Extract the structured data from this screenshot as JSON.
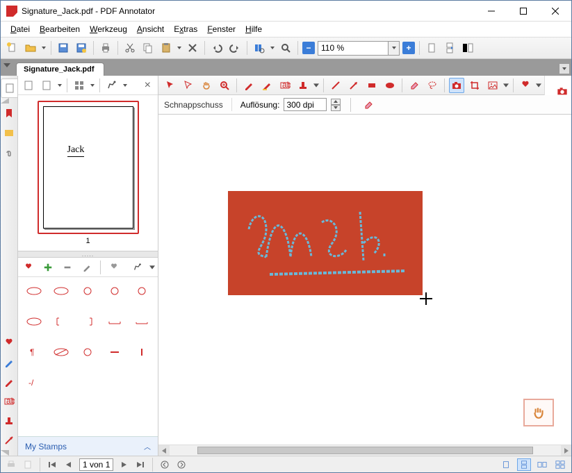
{
  "window": {
    "title": "Signature_Jack.pdf - PDF Annotator"
  },
  "menu": {
    "items": [
      "Datei",
      "Bearbeiten",
      "Werkzeug",
      "Ansicht",
      "Extras",
      "Fenster",
      "Hilfe"
    ]
  },
  "toolbar": {
    "zoom_value": "110 %"
  },
  "tab": {
    "document_name": "Signature_Jack.pdf"
  },
  "thumbnail": {
    "page_number": "1",
    "signature_text": "Jack"
  },
  "snapshot": {
    "label": "Schnappschuss",
    "resolution_label": "Auflösung:",
    "resolution_value": "300 dpi"
  },
  "canvas": {
    "signature_text": "Jack"
  },
  "stamps": {
    "footer_label": "My Stamps"
  },
  "statusbar": {
    "page_text": "1 von 1"
  },
  "splitter_dots": "....."
}
